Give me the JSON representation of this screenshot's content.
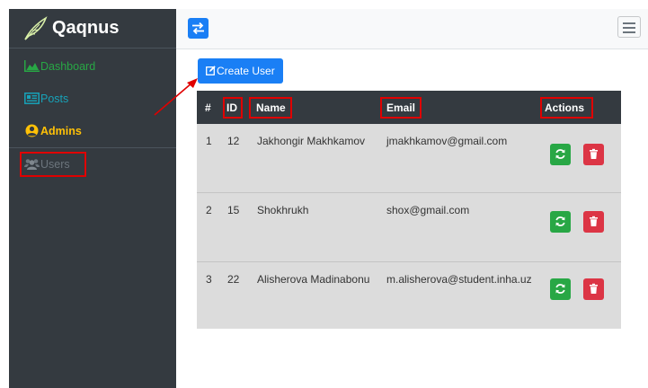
{
  "sidebar": {
    "brand": "Qaqnus",
    "items": [
      {
        "label": "Dashboard",
        "icon": "area-chart-icon",
        "color": "#28a745"
      },
      {
        "label": "Posts",
        "icon": "newspaper-icon",
        "color": "#17a2b8"
      },
      {
        "label": "Admins",
        "icon": "user-circle-icon",
        "color": "#ffc107"
      },
      {
        "label": "Users",
        "icon": "users-icon",
        "color": "#6c757d"
      }
    ]
  },
  "topbar": {
    "toggle_icon": "swap-arrows-icon",
    "menu_icon": "hamburger-icon"
  },
  "main": {
    "create_button": "Create User",
    "table": {
      "headers": [
        "#",
        "ID",
        "Name",
        "Email",
        "Actions"
      ],
      "rows": [
        {
          "num": "1",
          "id": "12",
          "name": "Jakhongir Makhkamov",
          "email": "jmakhkamov@gmail.com"
        },
        {
          "num": "2",
          "id": "15",
          "name": "Shokhrukh",
          "email": "shox@gmail.com"
        },
        {
          "num": "3",
          "id": "22",
          "name": "Alisherova Madinabonu",
          "email": "m.alisherova@student.inha.uz"
        }
      ]
    }
  },
  "colors": {
    "sidebar_bg": "#343a40",
    "primary": "#1a7ff5",
    "success": "#28a745",
    "danger": "#dc3545",
    "highlight": "#e00000"
  }
}
